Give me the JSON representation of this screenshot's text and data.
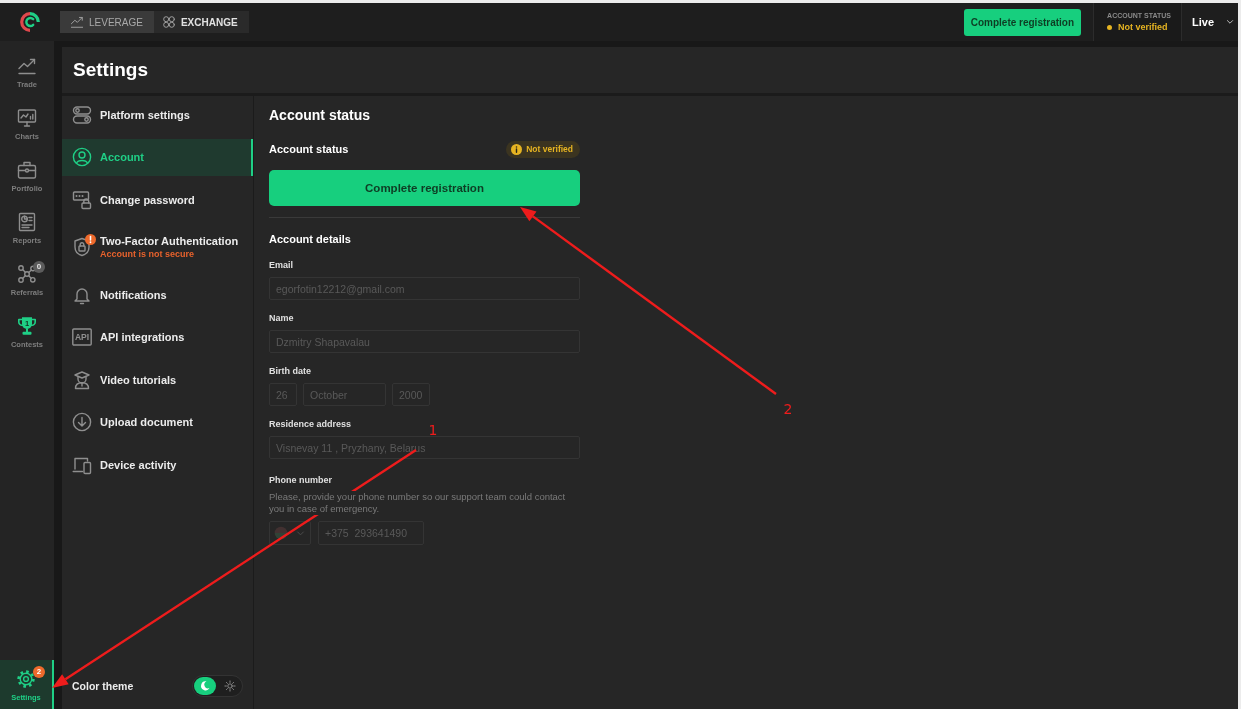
{
  "topbar": {
    "modes": [
      {
        "label": "LEVERAGE",
        "selected": true
      },
      {
        "label": "EXCHANGE",
        "selected": false
      }
    ],
    "register_button": "Complete registration",
    "account_status": {
      "label": "ACCOUNT STATUS",
      "value": "Not verified"
    },
    "account_mode": "Live"
  },
  "rail": {
    "items": [
      {
        "label": "Trade",
        "selected": false
      },
      {
        "label": "Charts",
        "selected": false
      },
      {
        "label": "Portfolio",
        "selected": false
      },
      {
        "label": "Reports",
        "selected": false
      },
      {
        "label": "Referrals",
        "selected": false,
        "badge": "0"
      },
      {
        "label": "Contests",
        "selected": false,
        "rank": "1"
      }
    ],
    "settings": {
      "label": "Settings",
      "selected": true,
      "badge": "2"
    }
  },
  "settings": {
    "title": "Settings",
    "menu": [
      {
        "label": "Platform settings",
        "selected": false,
        "alert": false
      },
      {
        "label": "Account",
        "selected": true,
        "alert": false
      },
      {
        "label": "Change password",
        "selected": false,
        "alert": false
      },
      {
        "label": "Two-Factor Authentication",
        "selected": false,
        "alert": true,
        "note": "Account is not secure"
      },
      {
        "label": "Notifications",
        "selected": false,
        "alert": false
      },
      {
        "label": "API integrations",
        "selected": false,
        "alert": false,
        "icon_text": "API"
      },
      {
        "label": "Video tutorials",
        "selected": false,
        "alert": false
      },
      {
        "label": "Upload document",
        "selected": false,
        "alert": false
      },
      {
        "label": "Device activity",
        "selected": false,
        "alert": false
      }
    ],
    "color_theme": {
      "label": "Color theme",
      "options": [
        {
          "kind": "dark",
          "selected": true
        },
        {
          "kind": "light",
          "selected": false
        }
      ]
    }
  },
  "account": {
    "title": "Account status",
    "status_label": "Account status",
    "status_badge": "Not verified",
    "register_button": "Complete registration",
    "details_title": "Account details",
    "fields": [
      {
        "kind": "text",
        "label": "Email",
        "inputs": [
          {
            "kind": "text",
            "value": "egorfotin12212@gmail.com",
            "disabled": true
          }
        ]
      },
      {
        "kind": "text",
        "label": "Name",
        "inputs": [
          {
            "kind": "text",
            "value": "Dzmitry Shapavalau",
            "disabled": true
          }
        ]
      },
      {
        "kind": "date",
        "label": "Birth date",
        "inputs": [
          {
            "kind": "text",
            "value": "26",
            "disabled": true
          },
          {
            "kind": "text",
            "value": "October",
            "disabled": true
          },
          {
            "kind": "text",
            "value": "2000",
            "disabled": true
          }
        ]
      },
      {
        "kind": "text",
        "label": "Residence address",
        "inputs": [
          {
            "kind": "text",
            "value": "Visnevay 11 , Pryzhany, Belarus",
            "disabled": true
          }
        ]
      },
      {
        "kind": "phone",
        "label": "Phone number",
        "note": "Please, provide your phone number so our support team could contact you in case of emergency.",
        "inputs": [
          {
            "kind": "select",
            "disabled": true
          },
          {
            "kind": "text",
            "value": "+375  293641490",
            "disabled": true
          }
        ]
      }
    ]
  },
  "annotations": [
    {
      "label": "1"
    },
    {
      "label": "2"
    }
  ]
}
